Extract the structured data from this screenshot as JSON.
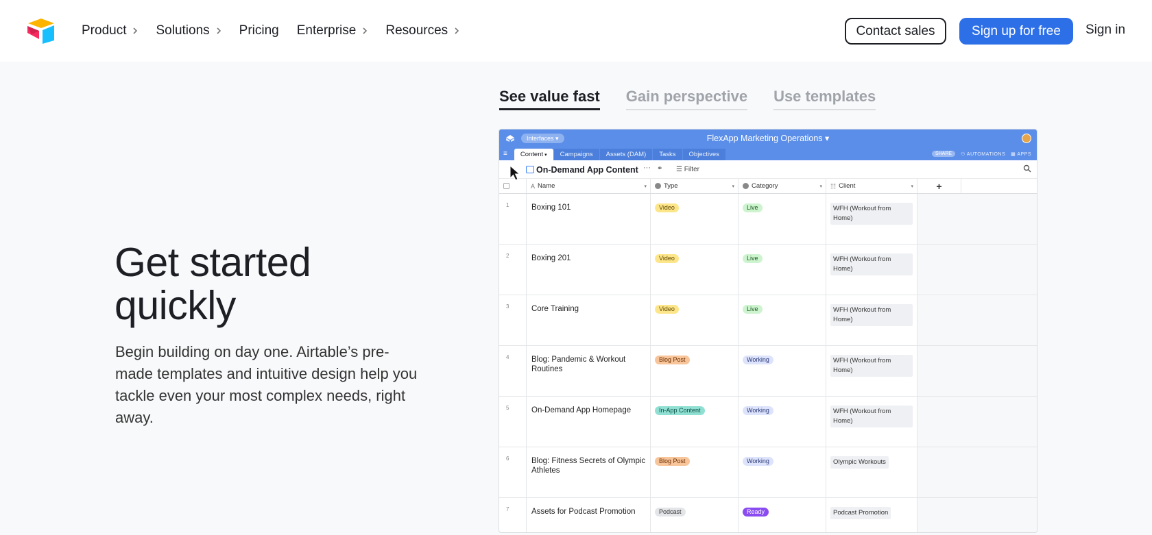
{
  "header": {
    "nav": [
      {
        "label": "Product",
        "has_chevron": true
      },
      {
        "label": "Solutions",
        "has_chevron": true
      },
      {
        "label": "Pricing",
        "has_chevron": false
      },
      {
        "label": "Enterprise",
        "has_chevron": true
      },
      {
        "label": "Resources",
        "has_chevron": true
      }
    ],
    "contact_sales": "Contact sales",
    "sign_up": "Sign up for free",
    "sign_in": "Sign in"
  },
  "hero": {
    "headline_line1": "Get started",
    "headline_line2": "quickly",
    "description": "Begin building on day one. Airtable’s pre-made templates and intuitive design help you tackle even your most complex needs, right away."
  },
  "feature_tabs": [
    {
      "label": "See value fast",
      "active": true
    },
    {
      "label": "Gain perspective",
      "active": false
    },
    {
      "label": "Use templates",
      "active": false
    }
  ],
  "app": {
    "interfaces_label": "Interfaces",
    "title": "FlexApp Marketing Operations",
    "tabs": [
      {
        "label": "Content",
        "active": true
      },
      {
        "label": "Campaigns",
        "active": false
      },
      {
        "label": "Assets (DAM)",
        "active": false
      },
      {
        "label": "Tasks",
        "active": false
      },
      {
        "label": "Objectives",
        "active": false
      }
    ],
    "share_label": "SHARE",
    "automations_label": "AUTOMATIONS",
    "apps_label": "APPS",
    "view_name": "On-Demand App Content",
    "filter_label": "Filter",
    "columns": [
      "Name",
      "Type",
      "Category",
      "Client"
    ],
    "rows": [
      {
        "num": "1",
        "name": "Boxing 101",
        "type": "Video",
        "category": "Live",
        "client": "WFH (Workout from Home)"
      },
      {
        "num": "2",
        "name": "Boxing 201",
        "type": "Video",
        "category": "Live",
        "client": "WFH (Workout from Home)"
      },
      {
        "num": "3",
        "name": "Core Training",
        "type": "Video",
        "category": "Live",
        "client": "WFH (Workout from Home)"
      },
      {
        "num": "4",
        "name": "Blog: Pandemic & Workout Routines",
        "type": "Blog Post",
        "category": "Working",
        "client": "WFH (Workout from Home)"
      },
      {
        "num": "5",
        "name": "On-Demand App Homepage",
        "type": "In-App Content",
        "category": "Working",
        "client": "WFH (Workout from Home)"
      },
      {
        "num": "6",
        "name": "Blog: Fitness Secrets of Olympic Athletes",
        "type": "Blog Post",
        "category": "Working",
        "client": "Olympic Workouts"
      },
      {
        "num": "7",
        "name": "Assets for Podcast Promotion",
        "type": "Podcast",
        "category": "Ready",
        "client": "Podcast Promotion"
      }
    ],
    "type_colors": {
      "Video": {
        "bg": "#fde68a",
        "fg": "#5c4400"
      },
      "Blog Post": {
        "bg": "#f8c49a",
        "fg": "#6a2e00"
      },
      "In-App Content": {
        "bg": "#8fe0d2",
        "fg": "#0b4c44"
      },
      "Podcast": {
        "bg": "#e4e5e8",
        "fg": "#333333"
      }
    },
    "category_colors": {
      "Live": {
        "bg": "#cdf4cf",
        "fg": "#1d5b22"
      },
      "Working": {
        "bg": "#dde3fb",
        "fg": "#2b3a78"
      },
      "Ready": {
        "bg": "#8a4cf0",
        "fg": "#ffffff"
      }
    }
  }
}
